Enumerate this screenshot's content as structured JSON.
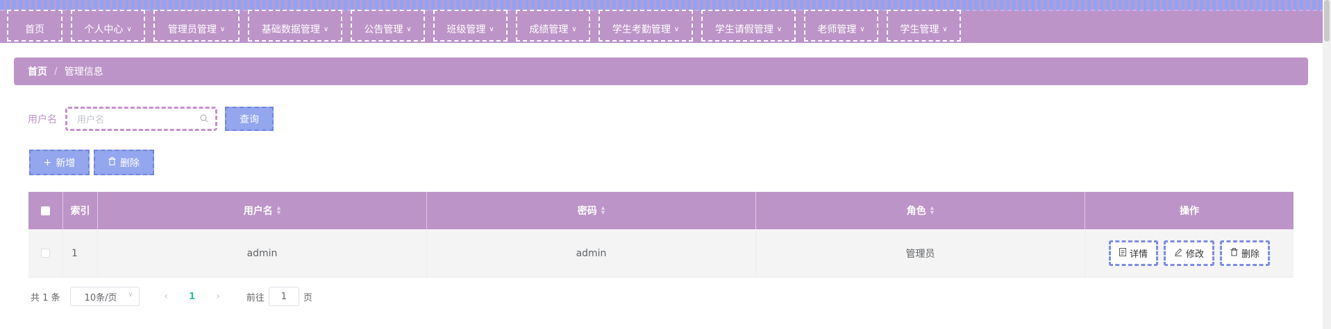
{
  "nav": {
    "items": [
      {
        "label": "首页",
        "dropdown": false
      },
      {
        "label": "个人中心",
        "dropdown": true
      },
      {
        "label": "管理员管理",
        "dropdown": true
      },
      {
        "label": "基础数据管理",
        "dropdown": true
      },
      {
        "label": "公告管理",
        "dropdown": true
      },
      {
        "label": "班级管理",
        "dropdown": true
      },
      {
        "label": "成绩管理",
        "dropdown": true
      },
      {
        "label": "学生考勤管理",
        "dropdown": true
      },
      {
        "label": "学生请假管理",
        "dropdown": true
      },
      {
        "label": "老师管理",
        "dropdown": true
      },
      {
        "label": "学生管理",
        "dropdown": true
      }
    ]
  },
  "breadcrumb": {
    "home": "首页",
    "separator": "/",
    "current": "管理信息"
  },
  "search": {
    "label": "用户名",
    "placeholder": "用户名",
    "value": "",
    "query_label": "查询"
  },
  "actions": {
    "add_label": "新增",
    "delete_label": "删除"
  },
  "table": {
    "headers": {
      "index": "索引",
      "username": "用户名",
      "password": "密码",
      "role": "角色",
      "operations": "操作"
    },
    "rows": [
      {
        "index": "1",
        "username": "admin",
        "password": "admin",
        "role": "管理员"
      }
    ],
    "row_actions": {
      "detail": "详情",
      "edit": "修改",
      "delete": "删除"
    }
  },
  "pagination": {
    "total": "共 1 条",
    "page_size": "10条/页",
    "current_page": "1",
    "goto_prefix": "前往",
    "goto_value": "1",
    "goto_suffix": "页"
  },
  "colors": {
    "theme": "#bd94c8",
    "button": "#93a6ee",
    "active_page": "#2db89e"
  }
}
